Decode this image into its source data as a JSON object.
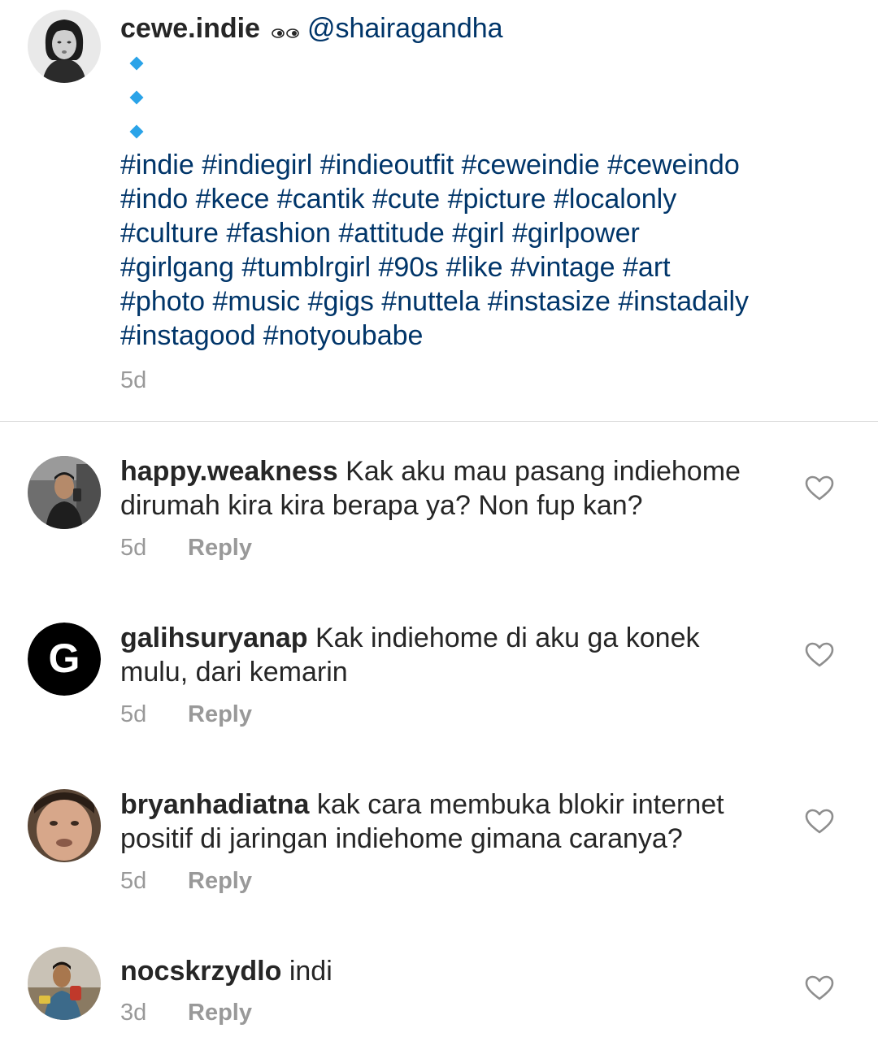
{
  "caption": {
    "username": "cewe.indie",
    "eyes_glyph": "eyes-icon",
    "mention": "@shairagandha",
    "hashtag_lines": [
      "#indie #indiegirl #indieoutfit #ceweindie #ceweindo",
      "#indo #kece #cantik #cute #picture #localonly",
      "#culture #fashion #attitude #girl #girlpower",
      "#girlgang #tumblrgirl #90s #like #vintage #art",
      "#photo #music #gigs #nuttela #instasize #instadaily",
      "#instagood #notyoubabe"
    ],
    "time": "5d"
  },
  "comments": [
    {
      "username": "happy.weakness",
      "text_first": "Kak aku mau pasang indiehome",
      "text_rest": "dirumah kira kira berapa ya? Non fup kan?",
      "time": "5d",
      "reply": "Reply"
    },
    {
      "username": "galihsuryanap",
      "avatar_letter": "G",
      "text_first": "Kak indiehome di aku ga konek",
      "text_rest": "mulu, dari kemarin",
      "time": "5d",
      "reply": "Reply"
    },
    {
      "username": "bryanhadiatna",
      "text_first": "kak cara membuka blokir internet",
      "text_rest": "positif di jaringan indiehome gimana caranya?",
      "time": "5d",
      "reply": "Reply"
    },
    {
      "username": "nocskrzydlo",
      "text_first": "indi",
      "text_rest": "",
      "time": "3d",
      "reply": "Reply"
    }
  ],
  "colors": {
    "hashtag": "#003569",
    "bullet": "#2aa3e8",
    "muted": "#999999",
    "text": "#262626"
  }
}
